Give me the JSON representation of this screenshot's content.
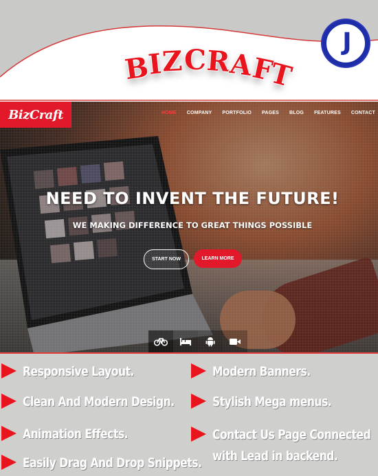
{
  "banner": {
    "title_letters": [
      "B",
      "I",
      "Z",
      "C",
      "R",
      "A",
      "F",
      "T"
    ],
    "colors": {
      "accent_red": "#e8141e",
      "wave_fill": "#ffffff",
      "logo_blue": "#1d2ea8"
    },
    "logo_letter": "J"
  },
  "site": {
    "brand": "BizCraft",
    "nav": [
      "HOME",
      "COMPANY",
      "PORTFOLIO",
      "PAGES",
      "BLOG",
      "FEATURES",
      "CONTACT"
    ],
    "active_nav": "HOME",
    "hero_title": "NEED TO INVENT THE FUTURE!",
    "hero_subtitle": "WE MAKING DIFFERENCE TO GREAT THINGS POSSIBLE",
    "start_button": "START NOW",
    "learn_button": "LEARN MORE",
    "tab_icons": [
      "bicycle-icon",
      "bed-icon",
      "android-icon",
      "video-camera-icon"
    ]
  },
  "features": {
    "left": [
      "Responsive Layout.",
      "Clean And Modern Design.",
      "Animation Effects.",
      "Easily Drag And Drop Snippets."
    ],
    "right": [
      "Modern Banners.",
      "Stylish Mega menus.",
      "Contact Us Page Connected with Lead in backend."
    ]
  }
}
